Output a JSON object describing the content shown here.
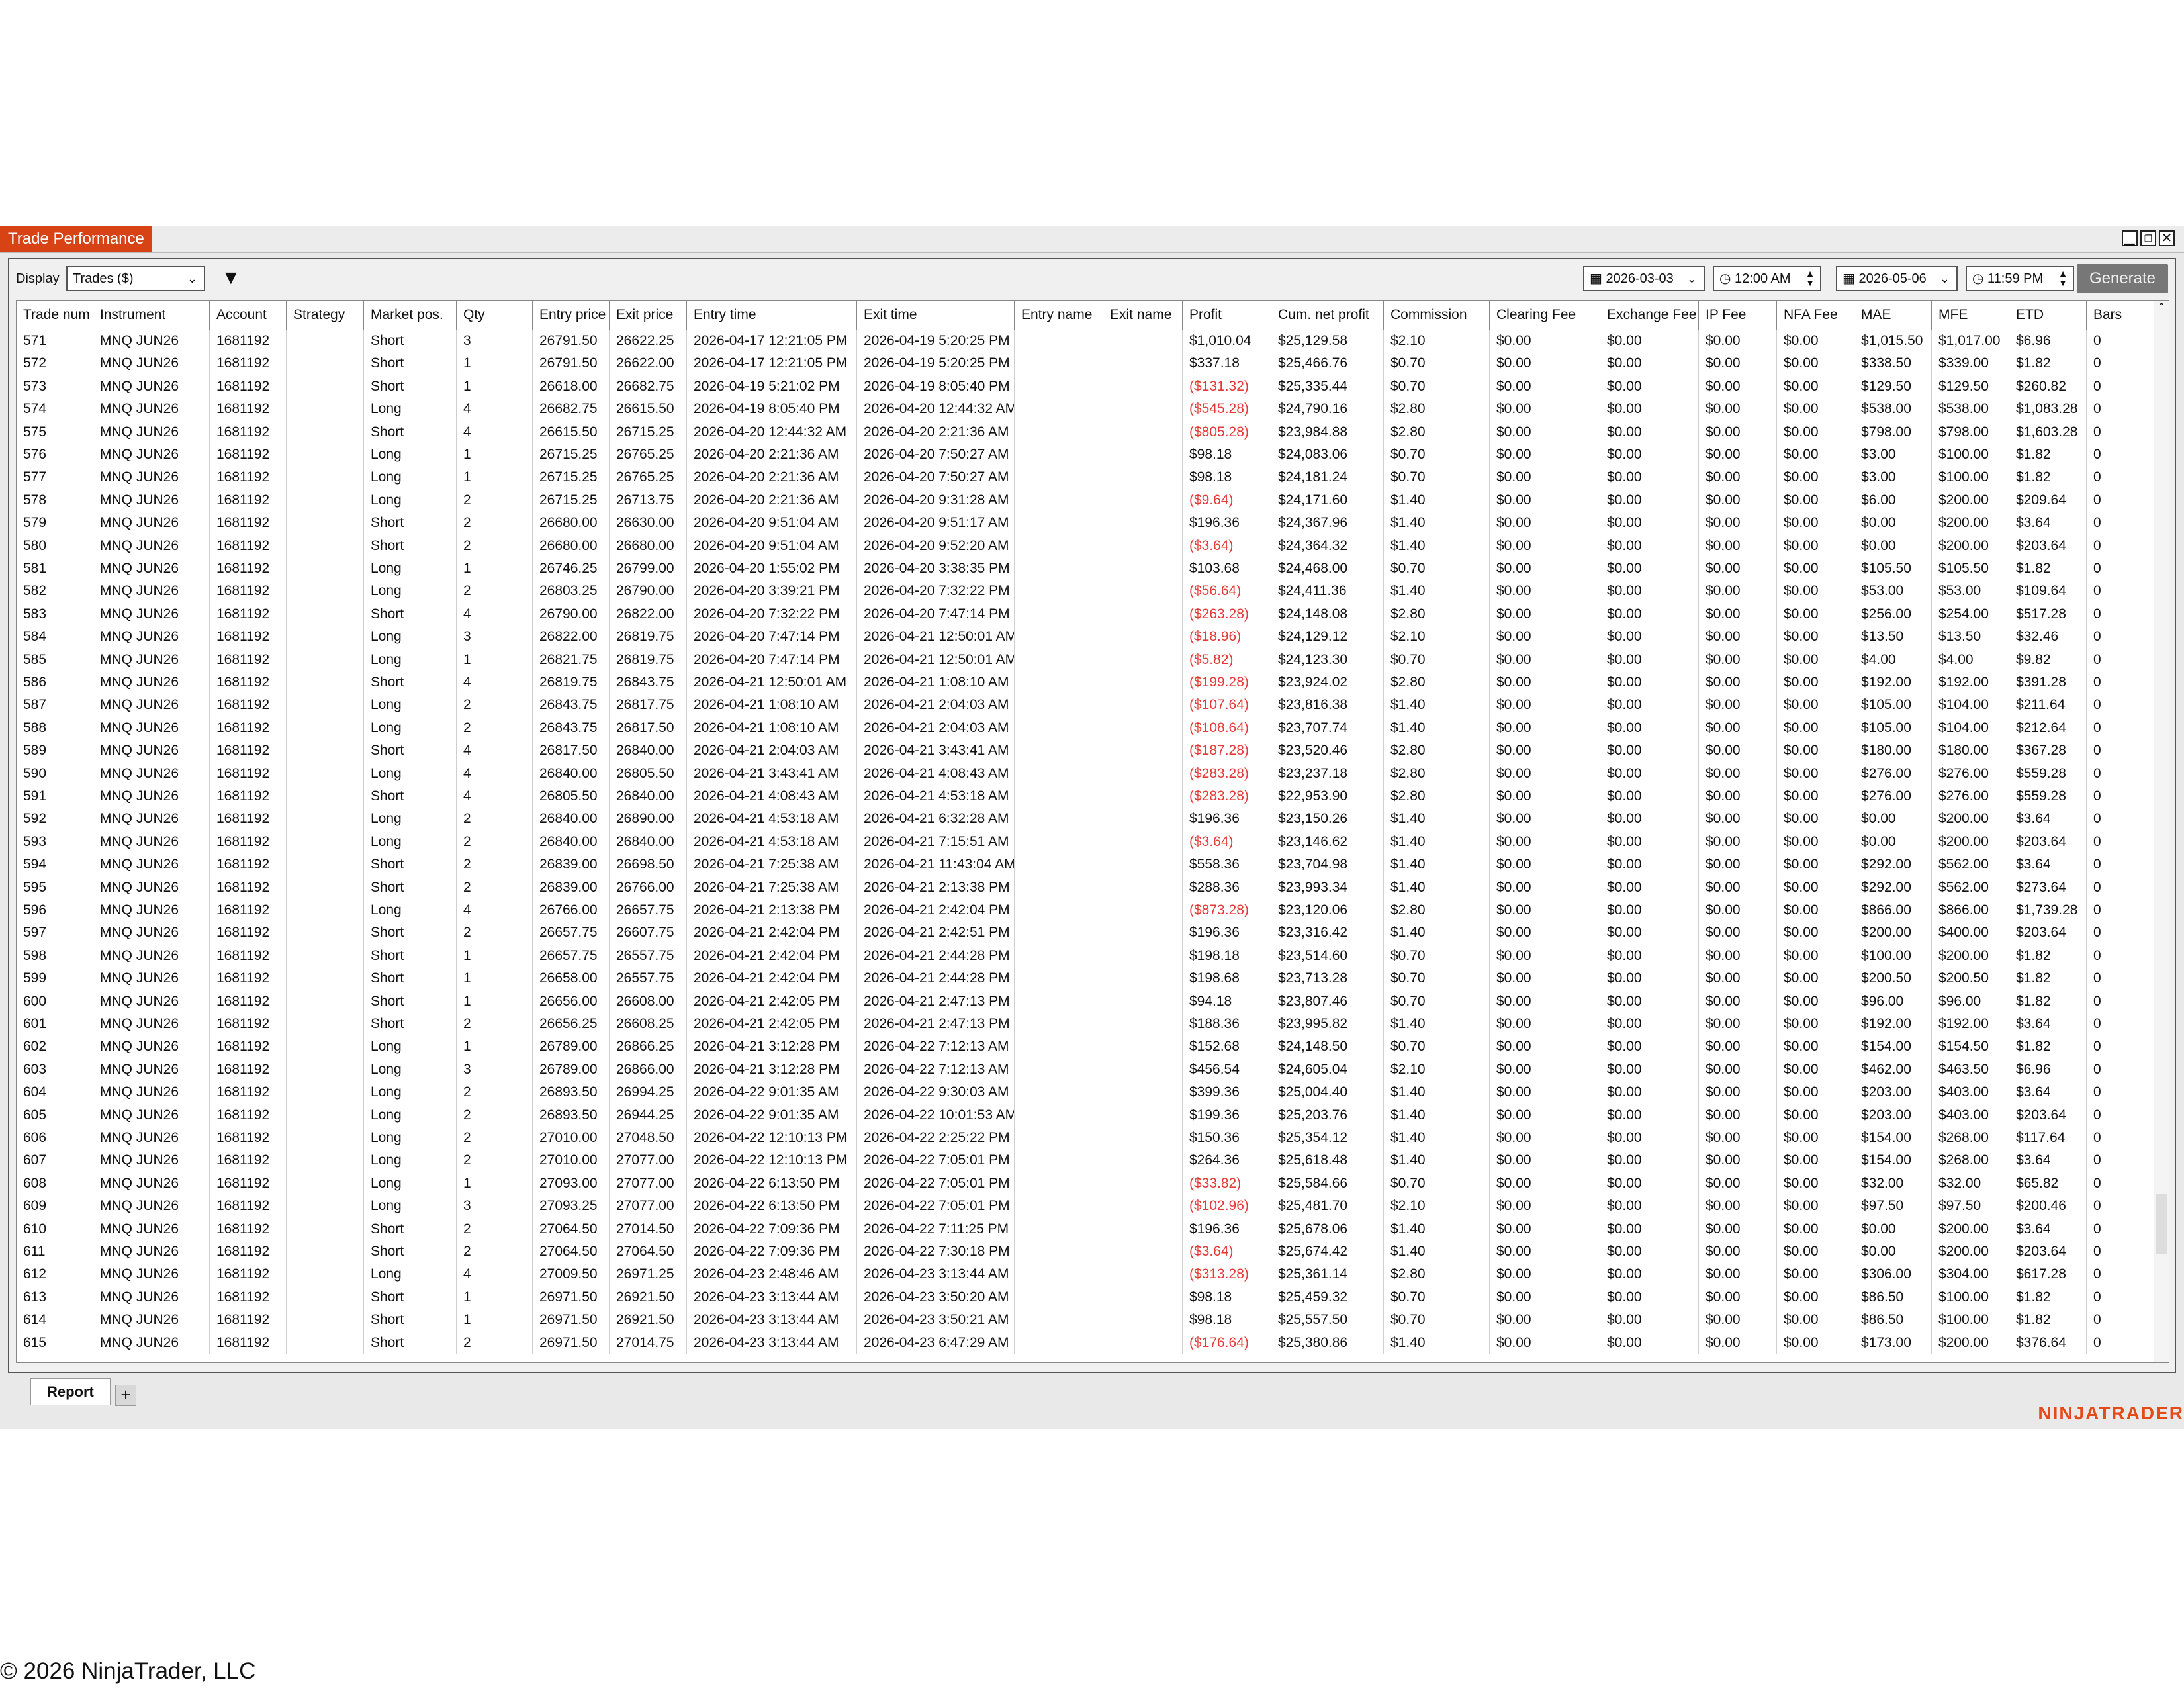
{
  "window": {
    "title": "Trade Performance",
    "controls": [
      "minimize",
      "restore",
      "close"
    ]
  },
  "toolbar": {
    "display_label": "Display",
    "display_value": "Trades ($)",
    "start_date": "2026-03-03",
    "start_time": "12:00 AM",
    "end_date": "2026-05-06",
    "end_time": "11:59 PM",
    "generate_label": "Generate",
    "icons": [
      "filter-icon",
      "calendar-icon",
      "clock-icon"
    ]
  },
  "columns": [
    "Trade num",
    "Instrument",
    "Account",
    "Strategy",
    "Market pos.",
    "Qty",
    "Entry price",
    "Exit price",
    "Entry time",
    "Exit time",
    "Entry name",
    "Exit name",
    "Profit",
    "Cum. net profit",
    "Commission",
    "Clearing Fee",
    "Exchange Fee",
    "IP Fee",
    "NFA Fee",
    "MAE",
    "MFE",
    "ETD",
    "Bars"
  ],
  "rows": [
    [
      "571",
      "MNQ JUN26",
      "1681192",
      "",
      "Short",
      "3",
      "26791.50",
      "26622.25",
      "2026-04-17 12:21:05 PM",
      "2026-04-19 5:20:25 PM",
      "",
      "",
      "$1,010.04",
      "$25,129.58",
      "$2.10",
      "$0.00",
      "$0.00",
      "$0.00",
      "$0.00",
      "$1,015.50",
      "$1,017.00",
      "$6.96",
      "0"
    ],
    [
      "572",
      "MNQ JUN26",
      "1681192",
      "",
      "Short",
      "1",
      "26791.50",
      "26622.00",
      "2026-04-17 12:21:05 PM",
      "2026-04-19 5:20:25 PM",
      "",
      "",
      "$337.18",
      "$25,466.76",
      "$0.70",
      "$0.00",
      "$0.00",
      "$0.00",
      "$0.00",
      "$338.50",
      "$339.00",
      "$1.82",
      "0"
    ],
    [
      "573",
      "MNQ JUN26",
      "1681192",
      "",
      "Short",
      "1",
      "26618.00",
      "26682.75",
      "2026-04-19 5:21:02 PM",
      "2026-04-19 8:05:40 PM",
      "",
      "",
      "($131.32)",
      "$25,335.44",
      "$0.70",
      "$0.00",
      "$0.00",
      "$0.00",
      "$0.00",
      "$129.50",
      "$129.50",
      "$260.82",
      "0"
    ],
    [
      "574",
      "MNQ JUN26",
      "1681192",
      "",
      "Long",
      "4",
      "26682.75",
      "26615.50",
      "2026-04-19 8:05:40 PM",
      "2026-04-20 12:44:32 AM",
      "",
      "",
      "($545.28)",
      "$24,790.16",
      "$2.80",
      "$0.00",
      "$0.00",
      "$0.00",
      "$0.00",
      "$538.00",
      "$538.00",
      "$1,083.28",
      "0"
    ],
    [
      "575",
      "MNQ JUN26",
      "1681192",
      "",
      "Short",
      "4",
      "26615.50",
      "26715.25",
      "2026-04-20 12:44:32 AM",
      "2026-04-20 2:21:36 AM",
      "",
      "",
      "($805.28)",
      "$23,984.88",
      "$2.80",
      "$0.00",
      "$0.00",
      "$0.00",
      "$0.00",
      "$798.00",
      "$798.00",
      "$1,603.28",
      "0"
    ],
    [
      "576",
      "MNQ JUN26",
      "1681192",
      "",
      "Long",
      "1",
      "26715.25",
      "26765.25",
      "2026-04-20 2:21:36 AM",
      "2026-04-20 7:50:27 AM",
      "",
      "",
      "$98.18",
      "$24,083.06",
      "$0.70",
      "$0.00",
      "$0.00",
      "$0.00",
      "$0.00",
      "$3.00",
      "$100.00",
      "$1.82",
      "0"
    ],
    [
      "577",
      "MNQ JUN26",
      "1681192",
      "",
      "Long",
      "1",
      "26715.25",
      "26765.25",
      "2026-04-20 2:21:36 AM",
      "2026-04-20 7:50:27 AM",
      "",
      "",
      "$98.18",
      "$24,181.24",
      "$0.70",
      "$0.00",
      "$0.00",
      "$0.00",
      "$0.00",
      "$3.00",
      "$100.00",
      "$1.82",
      "0"
    ],
    [
      "578",
      "MNQ JUN26",
      "1681192",
      "",
      "Long",
      "2",
      "26715.25",
      "26713.75",
      "2026-04-20 2:21:36 AM",
      "2026-04-20 9:31:28 AM",
      "",
      "",
      "($9.64)",
      "$24,171.60",
      "$1.40",
      "$0.00",
      "$0.00",
      "$0.00",
      "$0.00",
      "$6.00",
      "$200.00",
      "$209.64",
      "0"
    ],
    [
      "579",
      "MNQ JUN26",
      "1681192",
      "",
      "Short",
      "2",
      "26680.00",
      "26630.00",
      "2026-04-20 9:51:04 AM",
      "2026-04-20 9:51:17 AM",
      "",
      "",
      "$196.36",
      "$24,367.96",
      "$1.40",
      "$0.00",
      "$0.00",
      "$0.00",
      "$0.00",
      "$0.00",
      "$200.00",
      "$3.64",
      "0"
    ],
    [
      "580",
      "MNQ JUN26",
      "1681192",
      "",
      "Short",
      "2",
      "26680.00",
      "26680.00",
      "2026-04-20 9:51:04 AM",
      "2026-04-20 9:52:20 AM",
      "",
      "",
      "($3.64)",
      "$24,364.32",
      "$1.40",
      "$0.00",
      "$0.00",
      "$0.00",
      "$0.00",
      "$0.00",
      "$200.00",
      "$203.64",
      "0"
    ],
    [
      "581",
      "MNQ JUN26",
      "1681192",
      "",
      "Long",
      "1",
      "26746.25",
      "26799.00",
      "2026-04-20 1:55:02 PM",
      "2026-04-20 3:38:35 PM",
      "",
      "",
      "$103.68",
      "$24,468.00",
      "$0.70",
      "$0.00",
      "$0.00",
      "$0.00",
      "$0.00",
      "$105.50",
      "$105.50",
      "$1.82",
      "0"
    ],
    [
      "582",
      "MNQ JUN26",
      "1681192",
      "",
      "Long",
      "2",
      "26803.25",
      "26790.00",
      "2026-04-20 3:39:21 PM",
      "2026-04-20 7:32:22 PM",
      "",
      "",
      "($56.64)",
      "$24,411.36",
      "$1.40",
      "$0.00",
      "$0.00",
      "$0.00",
      "$0.00",
      "$53.00",
      "$53.00",
      "$109.64",
      "0"
    ],
    [
      "583",
      "MNQ JUN26",
      "1681192",
      "",
      "Short",
      "4",
      "26790.00",
      "26822.00",
      "2026-04-20 7:32:22 PM",
      "2026-04-20 7:47:14 PM",
      "",
      "",
      "($263.28)",
      "$24,148.08",
      "$2.80",
      "$0.00",
      "$0.00",
      "$0.00",
      "$0.00",
      "$256.00",
      "$254.00",
      "$517.28",
      "0"
    ],
    [
      "584",
      "MNQ JUN26",
      "1681192",
      "",
      "Long",
      "3",
      "26822.00",
      "26819.75",
      "2026-04-20 7:47:14 PM",
      "2026-04-21 12:50:01 AM",
      "",
      "",
      "($18.96)",
      "$24,129.12",
      "$2.10",
      "$0.00",
      "$0.00",
      "$0.00",
      "$0.00",
      "$13.50",
      "$13.50",
      "$32.46",
      "0"
    ],
    [
      "585",
      "MNQ JUN26",
      "1681192",
      "",
      "Long",
      "1",
      "26821.75",
      "26819.75",
      "2026-04-20 7:47:14 PM",
      "2026-04-21 12:50:01 AM",
      "",
      "",
      "($5.82)",
      "$24,123.30",
      "$0.70",
      "$0.00",
      "$0.00",
      "$0.00",
      "$0.00",
      "$4.00",
      "$4.00",
      "$9.82",
      "0"
    ],
    [
      "586",
      "MNQ JUN26",
      "1681192",
      "",
      "Short",
      "4",
      "26819.75",
      "26843.75",
      "2026-04-21 12:50:01 AM",
      "2026-04-21 1:08:10 AM",
      "",
      "",
      "($199.28)",
      "$23,924.02",
      "$2.80",
      "$0.00",
      "$0.00",
      "$0.00",
      "$0.00",
      "$192.00",
      "$192.00",
      "$391.28",
      "0"
    ],
    [
      "587",
      "MNQ JUN26",
      "1681192",
      "",
      "Long",
      "2",
      "26843.75",
      "26817.75",
      "2026-04-21 1:08:10 AM",
      "2026-04-21 2:04:03 AM",
      "",
      "",
      "($107.64)",
      "$23,816.38",
      "$1.40",
      "$0.00",
      "$0.00",
      "$0.00",
      "$0.00",
      "$105.00",
      "$104.00",
      "$211.64",
      "0"
    ],
    [
      "588",
      "MNQ JUN26",
      "1681192",
      "",
      "Long",
      "2",
      "26843.75",
      "26817.50",
      "2026-04-21 1:08:10 AM",
      "2026-04-21 2:04:03 AM",
      "",
      "",
      "($108.64)",
      "$23,707.74",
      "$1.40",
      "$0.00",
      "$0.00",
      "$0.00",
      "$0.00",
      "$105.00",
      "$104.00",
      "$212.64",
      "0"
    ],
    [
      "589",
      "MNQ JUN26",
      "1681192",
      "",
      "Short",
      "4",
      "26817.50",
      "26840.00",
      "2026-04-21 2:04:03 AM",
      "2026-04-21 3:43:41 AM",
      "",
      "",
      "($187.28)",
      "$23,520.46",
      "$2.80",
      "$0.00",
      "$0.00",
      "$0.00",
      "$0.00",
      "$180.00",
      "$180.00",
      "$367.28",
      "0"
    ],
    [
      "590",
      "MNQ JUN26",
      "1681192",
      "",
      "Long",
      "4",
      "26840.00",
      "26805.50",
      "2026-04-21 3:43:41 AM",
      "2026-04-21 4:08:43 AM",
      "",
      "",
      "($283.28)",
      "$23,237.18",
      "$2.80",
      "$0.00",
      "$0.00",
      "$0.00",
      "$0.00",
      "$276.00",
      "$276.00",
      "$559.28",
      "0"
    ],
    [
      "591",
      "MNQ JUN26",
      "1681192",
      "",
      "Short",
      "4",
      "26805.50",
      "26840.00",
      "2026-04-21 4:08:43 AM",
      "2026-04-21 4:53:18 AM",
      "",
      "",
      "($283.28)",
      "$22,953.90",
      "$2.80",
      "$0.00",
      "$0.00",
      "$0.00",
      "$0.00",
      "$276.00",
      "$276.00",
      "$559.28",
      "0"
    ],
    [
      "592",
      "MNQ JUN26",
      "1681192",
      "",
      "Long",
      "2",
      "26840.00",
      "26890.00",
      "2026-04-21 4:53:18 AM",
      "2026-04-21 6:32:28 AM",
      "",
      "",
      "$196.36",
      "$23,150.26",
      "$1.40",
      "$0.00",
      "$0.00",
      "$0.00",
      "$0.00",
      "$0.00",
      "$200.00",
      "$3.64",
      "0"
    ],
    [
      "593",
      "MNQ JUN26",
      "1681192",
      "",
      "Long",
      "2",
      "26840.00",
      "26840.00",
      "2026-04-21 4:53:18 AM",
      "2026-04-21 7:15:51 AM",
      "",
      "",
      "($3.64)",
      "$23,146.62",
      "$1.40",
      "$0.00",
      "$0.00",
      "$0.00",
      "$0.00",
      "$0.00",
      "$200.00",
      "$203.64",
      "0"
    ],
    [
      "594",
      "MNQ JUN26",
      "1681192",
      "",
      "Short",
      "2",
      "26839.00",
      "26698.50",
      "2026-04-21 7:25:38 AM",
      "2026-04-21 11:43:04 AM",
      "",
      "",
      "$558.36",
      "$23,704.98",
      "$1.40",
      "$0.00",
      "$0.00",
      "$0.00",
      "$0.00",
      "$292.00",
      "$562.00",
      "$3.64",
      "0"
    ],
    [
      "595",
      "MNQ JUN26",
      "1681192",
      "",
      "Short",
      "2",
      "26839.00",
      "26766.00",
      "2026-04-21 7:25:38 AM",
      "2026-04-21 2:13:38 PM",
      "",
      "",
      "$288.36",
      "$23,993.34",
      "$1.40",
      "$0.00",
      "$0.00",
      "$0.00",
      "$0.00",
      "$292.00",
      "$562.00",
      "$273.64",
      "0"
    ],
    [
      "596",
      "MNQ JUN26",
      "1681192",
      "",
      "Long",
      "4",
      "26766.00",
      "26657.75",
      "2026-04-21 2:13:38 PM",
      "2026-04-21 2:42:04 PM",
      "",
      "",
      "($873.28)",
      "$23,120.06",
      "$2.80",
      "$0.00",
      "$0.00",
      "$0.00",
      "$0.00",
      "$866.00",
      "$866.00",
      "$1,739.28",
      "0"
    ],
    [
      "597",
      "MNQ JUN26",
      "1681192",
      "",
      "Short",
      "2",
      "26657.75",
      "26607.75",
      "2026-04-21 2:42:04 PM",
      "2026-04-21 2:42:51 PM",
      "",
      "",
      "$196.36",
      "$23,316.42",
      "$1.40",
      "$0.00",
      "$0.00",
      "$0.00",
      "$0.00",
      "$200.00",
      "$400.00",
      "$203.64",
      "0"
    ],
    [
      "598",
      "MNQ JUN26",
      "1681192",
      "",
      "Short",
      "1",
      "26657.75",
      "26557.75",
      "2026-04-21 2:42:04 PM",
      "2026-04-21 2:44:28 PM",
      "",
      "",
      "$198.18",
      "$23,514.60",
      "$0.70",
      "$0.00",
      "$0.00",
      "$0.00",
      "$0.00",
      "$100.00",
      "$200.00",
      "$1.82",
      "0"
    ],
    [
      "599",
      "MNQ JUN26",
      "1681192",
      "",
      "Short",
      "1",
      "26658.00",
      "26557.75",
      "2026-04-21 2:42:04 PM",
      "2026-04-21 2:44:28 PM",
      "",
      "",
      "$198.68",
      "$23,713.28",
      "$0.70",
      "$0.00",
      "$0.00",
      "$0.00",
      "$0.00",
      "$200.50",
      "$200.50",
      "$1.82",
      "0"
    ],
    [
      "600",
      "MNQ JUN26",
      "1681192",
      "",
      "Short",
      "1",
      "26656.00",
      "26608.00",
      "2026-04-21 2:42:05 PM",
      "2026-04-21 2:47:13 PM",
      "",
      "",
      "$94.18",
      "$23,807.46",
      "$0.70",
      "$0.00",
      "$0.00",
      "$0.00",
      "$0.00",
      "$96.00",
      "$96.00",
      "$1.82",
      "0"
    ],
    [
      "601",
      "MNQ JUN26",
      "1681192",
      "",
      "Short",
      "2",
      "26656.25",
      "26608.25",
      "2026-04-21 2:42:05 PM",
      "2026-04-21 2:47:13 PM",
      "",
      "",
      "$188.36",
      "$23,995.82",
      "$1.40",
      "$0.00",
      "$0.00",
      "$0.00",
      "$0.00",
      "$192.00",
      "$192.00",
      "$3.64",
      "0"
    ],
    [
      "602",
      "MNQ JUN26",
      "1681192",
      "",
      "Long",
      "1",
      "26789.00",
      "26866.25",
      "2026-04-21 3:12:28 PM",
      "2026-04-22 7:12:13 AM",
      "",
      "",
      "$152.68",
      "$24,148.50",
      "$0.70",
      "$0.00",
      "$0.00",
      "$0.00",
      "$0.00",
      "$154.00",
      "$154.50",
      "$1.82",
      "0"
    ],
    [
      "603",
      "MNQ JUN26",
      "1681192",
      "",
      "Long",
      "3",
      "26789.00",
      "26866.00",
      "2026-04-21 3:12:28 PM",
      "2026-04-22 7:12:13 AM",
      "",
      "",
      "$456.54",
      "$24,605.04",
      "$2.10",
      "$0.00",
      "$0.00",
      "$0.00",
      "$0.00",
      "$462.00",
      "$463.50",
      "$6.96",
      "0"
    ],
    [
      "604",
      "MNQ JUN26",
      "1681192",
      "",
      "Long",
      "2",
      "26893.50",
      "26994.25",
      "2026-04-22 9:01:35 AM",
      "2026-04-22 9:30:03 AM",
      "",
      "",
      "$399.36",
      "$25,004.40",
      "$1.40",
      "$0.00",
      "$0.00",
      "$0.00",
      "$0.00",
      "$203.00",
      "$403.00",
      "$3.64",
      "0"
    ],
    [
      "605",
      "MNQ JUN26",
      "1681192",
      "",
      "Long",
      "2",
      "26893.50",
      "26944.25",
      "2026-04-22 9:01:35 AM",
      "2026-04-22 10:01:53 AM",
      "",
      "",
      "$199.36",
      "$25,203.76",
      "$1.40",
      "$0.00",
      "$0.00",
      "$0.00",
      "$0.00",
      "$203.00",
      "$403.00",
      "$203.64",
      "0"
    ],
    [
      "606",
      "MNQ JUN26",
      "1681192",
      "",
      "Long",
      "2",
      "27010.00",
      "27048.50",
      "2026-04-22 12:10:13 PM",
      "2026-04-22 2:25:22 PM",
      "",
      "",
      "$150.36",
      "$25,354.12",
      "$1.40",
      "$0.00",
      "$0.00",
      "$0.00",
      "$0.00",
      "$154.00",
      "$268.00",
      "$117.64",
      "0"
    ],
    [
      "607",
      "MNQ JUN26",
      "1681192",
      "",
      "Long",
      "2",
      "27010.00",
      "27077.00",
      "2026-04-22 12:10:13 PM",
      "2026-04-22 7:05:01 PM",
      "",
      "",
      "$264.36",
      "$25,618.48",
      "$1.40",
      "$0.00",
      "$0.00",
      "$0.00",
      "$0.00",
      "$154.00",
      "$268.00",
      "$3.64",
      "0"
    ],
    [
      "608",
      "MNQ JUN26",
      "1681192",
      "",
      "Long",
      "1",
      "27093.00",
      "27077.00",
      "2026-04-22 6:13:50 PM",
      "2026-04-22 7:05:01 PM",
      "",
      "",
      "($33.82)",
      "$25,584.66",
      "$0.70",
      "$0.00",
      "$0.00",
      "$0.00",
      "$0.00",
      "$32.00",
      "$32.00",
      "$65.82",
      "0"
    ],
    [
      "609",
      "MNQ JUN26",
      "1681192",
      "",
      "Long",
      "3",
      "27093.25",
      "27077.00",
      "2026-04-22 6:13:50 PM",
      "2026-04-22 7:05:01 PM",
      "",
      "",
      "($102.96)",
      "$25,481.70",
      "$2.10",
      "$0.00",
      "$0.00",
      "$0.00",
      "$0.00",
      "$97.50",
      "$97.50",
      "$200.46",
      "0"
    ],
    [
      "610",
      "MNQ JUN26",
      "1681192",
      "",
      "Short",
      "2",
      "27064.50",
      "27014.50",
      "2026-04-22 7:09:36 PM",
      "2026-04-22 7:11:25 PM",
      "",
      "",
      "$196.36",
      "$25,678.06",
      "$1.40",
      "$0.00",
      "$0.00",
      "$0.00",
      "$0.00",
      "$0.00",
      "$200.00",
      "$3.64",
      "0"
    ],
    [
      "611",
      "MNQ JUN26",
      "1681192",
      "",
      "Short",
      "2",
      "27064.50",
      "27064.50",
      "2026-04-22 7:09:36 PM",
      "2026-04-22 7:30:18 PM",
      "",
      "",
      "($3.64)",
      "$25,674.42",
      "$1.40",
      "$0.00",
      "$0.00",
      "$0.00",
      "$0.00",
      "$0.00",
      "$200.00",
      "$203.64",
      "0"
    ],
    [
      "612",
      "MNQ JUN26",
      "1681192",
      "",
      "Long",
      "4",
      "27009.50",
      "26971.25",
      "2026-04-23 2:48:46 AM",
      "2026-04-23 3:13:44 AM",
      "",
      "",
      "($313.28)",
      "$25,361.14",
      "$2.80",
      "$0.00",
      "$0.00",
      "$0.00",
      "$0.00",
      "$306.00",
      "$304.00",
      "$617.28",
      "0"
    ],
    [
      "613",
      "MNQ JUN26",
      "1681192",
      "",
      "Short",
      "1",
      "26971.50",
      "26921.50",
      "2026-04-23 3:13:44 AM",
      "2026-04-23 3:50:20 AM",
      "",
      "",
      "$98.18",
      "$25,459.32",
      "$0.70",
      "$0.00",
      "$0.00",
      "$0.00",
      "$0.00",
      "$86.50",
      "$100.00",
      "$1.82",
      "0"
    ],
    [
      "614",
      "MNQ JUN26",
      "1681192",
      "",
      "Short",
      "1",
      "26971.50",
      "26921.50",
      "2026-04-23 3:13:44 AM",
      "2026-04-23 3:50:21 AM",
      "",
      "",
      "$98.18",
      "$25,557.50",
      "$0.70",
      "$0.00",
      "$0.00",
      "$0.00",
      "$0.00",
      "$86.50",
      "$100.00",
      "$1.82",
      "0"
    ],
    [
      "615",
      "MNQ JUN26",
      "1681192",
      "",
      "Short",
      "2",
      "26971.50",
      "27014.75",
      "2026-04-23 3:13:44 AM",
      "2026-04-23 6:47:29 AM",
      "",
      "",
      "($176.64)",
      "$25,380.86",
      "$1.40",
      "$0.00",
      "$0.00",
      "$0.00",
      "$0.00",
      "$173.00",
      "$200.00",
      "$376.64",
      "0"
    ]
  ],
  "tabs": [
    {
      "label": "Report",
      "active": true
    }
  ],
  "add_tab_label": "+",
  "brand": "NINJATRADER",
  "copyright": "© 2026 NinjaTrader, LLC",
  "colors": {
    "title_bg": "#d84315",
    "negative": "#e53935",
    "brand": "#e64a19"
  }
}
